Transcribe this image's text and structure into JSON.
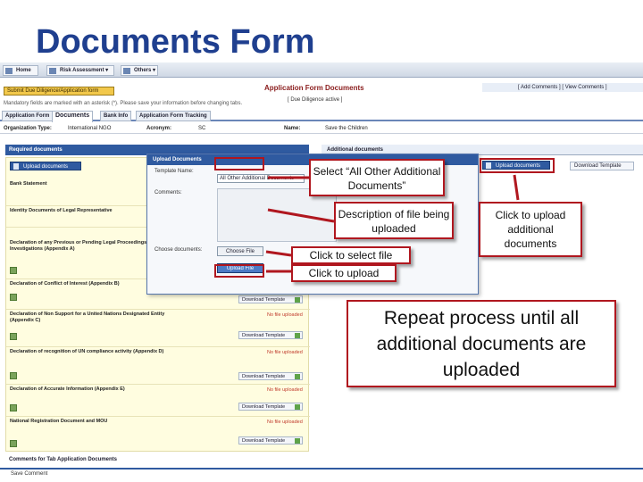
{
  "slide": {
    "title": "Documents Form"
  },
  "nav": {
    "home": "Home",
    "risk": "Risk Assessment ▾",
    "others": "Others ▾"
  },
  "header": {
    "due_diligence_button": "Submit Due Diligence/Application form",
    "mandatory_note": "Mandatory fields are marked with an asterisk (*). Please save your information before changing tabs.",
    "app_title": "Application Form Documents",
    "app_subtitle": "[ Due Diligence active ]",
    "links": "[ Add Comments ]   [ View Comments ]"
  },
  "tabs": [
    {
      "label": "Application Form"
    },
    {
      "label": "Documents"
    },
    {
      "label": "Bank Info"
    },
    {
      "label": "Application Form Tracking"
    }
  ],
  "org": {
    "type_label": "Organization Type:",
    "type_value": "International NGO",
    "acronym_label": "Acronym:",
    "acronym_value": "SC",
    "name_label": "Name:",
    "name_value": "Save the Children"
  },
  "required": {
    "header": "Required documents",
    "upload_button": "Upload documents",
    "download_template": "Download Template",
    "no_file": "No file uploaded",
    "documents": [
      {
        "name": "Bank Statement"
      },
      {
        "name": "Identity Documents of Legal Representative"
      },
      {
        "name": "Declaration of any Previous or Pending Legal Proceedings / Investigations (Appendix A)"
      },
      {
        "name": "Declaration of Conflict of Interest (Appendix B)"
      },
      {
        "name": "Declaration of Non Support for a United Nations Designated Entity (Appendix C)"
      },
      {
        "name": "Declaration of recognition of UN compliance activity (Appendix D)"
      },
      {
        "name": "Declaration of Accurate Information (Appendix E)"
      },
      {
        "name": "National Registration Document and MOU"
      }
    ]
  },
  "additional": {
    "header": "Additional documents",
    "upload_button": "Upload documents",
    "download_template": "Download Template"
  },
  "modal": {
    "title": "Upload Documents",
    "template_label": "Template Name:",
    "template_value": "All Other Additional Documents",
    "comments_label": "Comments:",
    "choose_label": "Choose documents:",
    "choose_button": "Choose File",
    "upload_button": "Upload File"
  },
  "footer": {
    "comments_header": "Comments for Tab Application Documents",
    "save_comment": "Save Comment"
  },
  "callouts": {
    "select": "Select “All Other Additional Documents”",
    "description": "Description of file being uploaded",
    "select_file": "Click to select file",
    "upload": "Click to upload",
    "upload_additional": "Click to upload additional documents",
    "repeat": "Repeat process until all additional documents are uploaded"
  },
  "colors": {
    "title": "#1f3f8f",
    "highlight": "#b0171f",
    "app_blue": "#2f5aa0",
    "required_bg": "#fffde0"
  }
}
